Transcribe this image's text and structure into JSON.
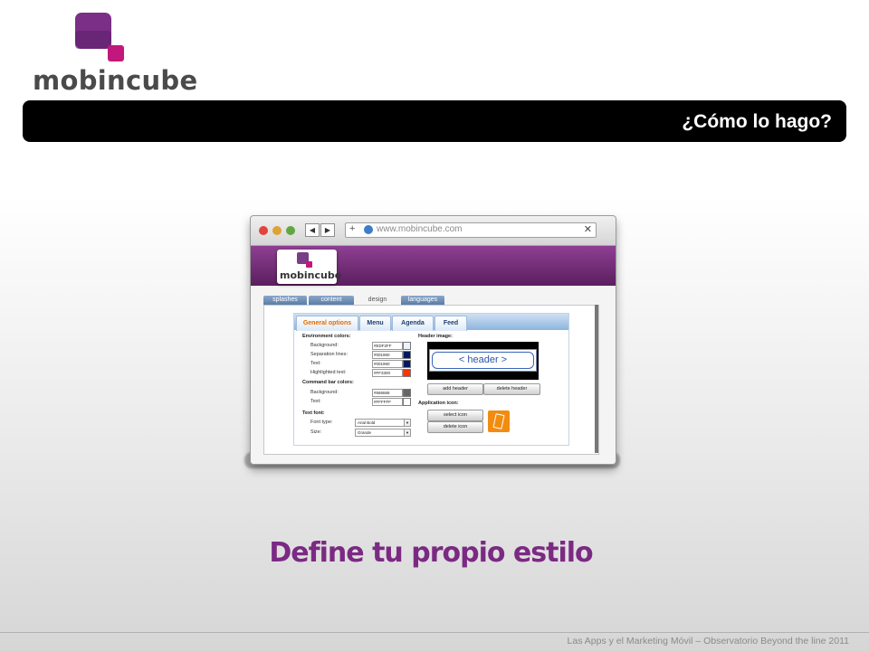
{
  "brand": {
    "name": "mobincube",
    "colors": {
      "purple": "#7b2a83",
      "magenta": "#c2177c",
      "dark": "#4a4a4a"
    }
  },
  "section_title": "¿Cómo lo hago?",
  "browser": {
    "url": "www.mobincube.com",
    "close_glyph": "✕",
    "plus_glyph": "+",
    "back_glyph": "◀",
    "forward_glyph": "▶",
    "site_logo": "mobincube",
    "top_tabs": [
      "splashes",
      "content",
      "design",
      "languages"
    ],
    "active_top_tab": "design",
    "inner_tabs": [
      "General options",
      "Menu",
      "Agenda",
      "Feed"
    ],
    "active_inner_tab": "General options",
    "env_colors": {
      "heading": "Environment colors:",
      "rows": [
        {
          "label": "Background:",
          "hex": "#EDF2FF",
          "color": "#EDF2FF"
        },
        {
          "label": "Separation lines:",
          "hex": "#001960",
          "color": "#001960"
        },
        {
          "label": "Text:",
          "hex": "#001960",
          "color": "#001960"
        },
        {
          "label": "Highlighted text:",
          "hex": "#FF3300",
          "color": "#FF3300"
        }
      ]
    },
    "cmd_colors": {
      "heading": "Command bar colors:",
      "rows": [
        {
          "label": "Background:",
          "hex": "#666666",
          "color": "#666666"
        },
        {
          "label": "Text:",
          "hex": "#FFFFFF",
          "color": "#FFFFFF"
        }
      ]
    },
    "text_font": {
      "heading": "Text font:",
      "font_type_label": "Font type:",
      "font_type_value": "Arial Bold",
      "size_label": "Size:",
      "size_value": "Grande"
    },
    "header_image": {
      "heading": "Header image:",
      "placeholder": "< header >",
      "add_label": "add header",
      "delete_label": "delete header"
    },
    "app_icon": {
      "heading": "Application icon:",
      "select_label": "select icon",
      "delete_label": "delete icon"
    }
  },
  "tagline": "Define tu propio estilo",
  "footer": "Las Apps y el Marketing Móvil – Observatorio Beyond the line 2011"
}
